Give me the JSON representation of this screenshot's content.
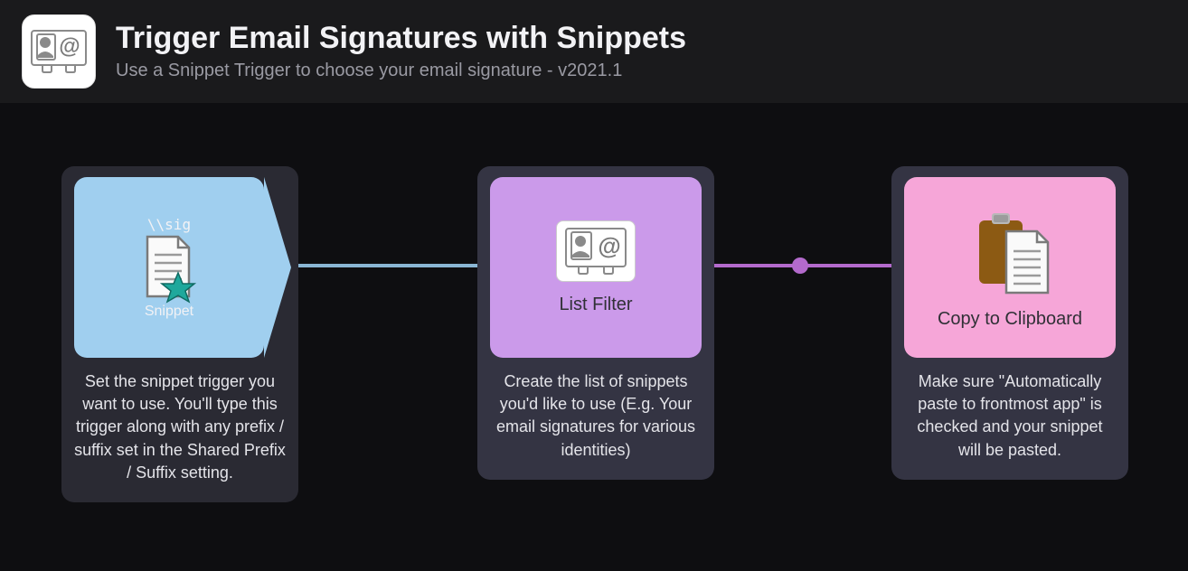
{
  "header": {
    "title": "Trigger Email Signatures with Snippets",
    "subtitle": "Use a Snippet Trigger to choose your email signature - v2021.1"
  },
  "nodes": {
    "snippet": {
      "trigger_text": "\\\\sig",
      "label": "Snippet",
      "description": "Set the snippet trigger you want to use. You'll type this trigger along with any prefix / suffix set in the Shared Prefix / Suffix setting."
    },
    "listfilter": {
      "label": "List Filter",
      "description": "Create the list of snippets you'd like to use (E.g. Your email signatures for various identities)"
    },
    "clipboard": {
      "label": "Copy to Clipboard",
      "description": "Make sure \"Automatically paste to frontmost app\" is checked and your snippet will be pasted."
    }
  }
}
